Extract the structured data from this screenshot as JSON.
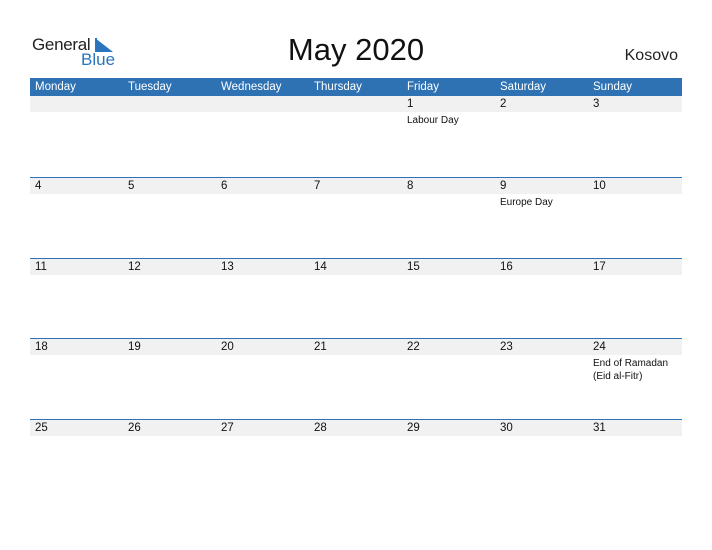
{
  "logo": {
    "general": "General",
    "blue": "Blue"
  },
  "title": "May 2020",
  "country": "Kosovo",
  "colors": {
    "accent": "#2e72b4",
    "date_strip": "#f1f1f1"
  },
  "weekdays": [
    "Monday",
    "Tuesday",
    "Wednesday",
    "Thursday",
    "Friday",
    "Saturday",
    "Sunday"
  ],
  "weeks": [
    {
      "dates": [
        "",
        "",
        "",
        "",
        "1",
        "2",
        "3"
      ],
      "events": [
        "",
        "",
        "",
        "",
        "Labour Day",
        "",
        ""
      ]
    },
    {
      "dates": [
        "4",
        "5",
        "6",
        "7",
        "8",
        "9",
        "10"
      ],
      "events": [
        "",
        "",
        "",
        "",
        "",
        "Europe Day",
        ""
      ]
    },
    {
      "dates": [
        "11",
        "12",
        "13",
        "14",
        "15",
        "16",
        "17"
      ],
      "events": [
        "",
        "",
        "",
        "",
        "",
        "",
        ""
      ]
    },
    {
      "dates": [
        "18",
        "19",
        "20",
        "21",
        "22",
        "23",
        "24"
      ],
      "events": [
        "",
        "",
        "",
        "",
        "",
        "",
        "End of Ramadan\n(Eid al-Fitr)"
      ]
    },
    {
      "dates": [
        "25",
        "26",
        "27",
        "28",
        "29",
        "30",
        "31"
      ],
      "events": [
        "",
        "",
        "",
        "",
        "",
        "",
        ""
      ]
    }
  ]
}
